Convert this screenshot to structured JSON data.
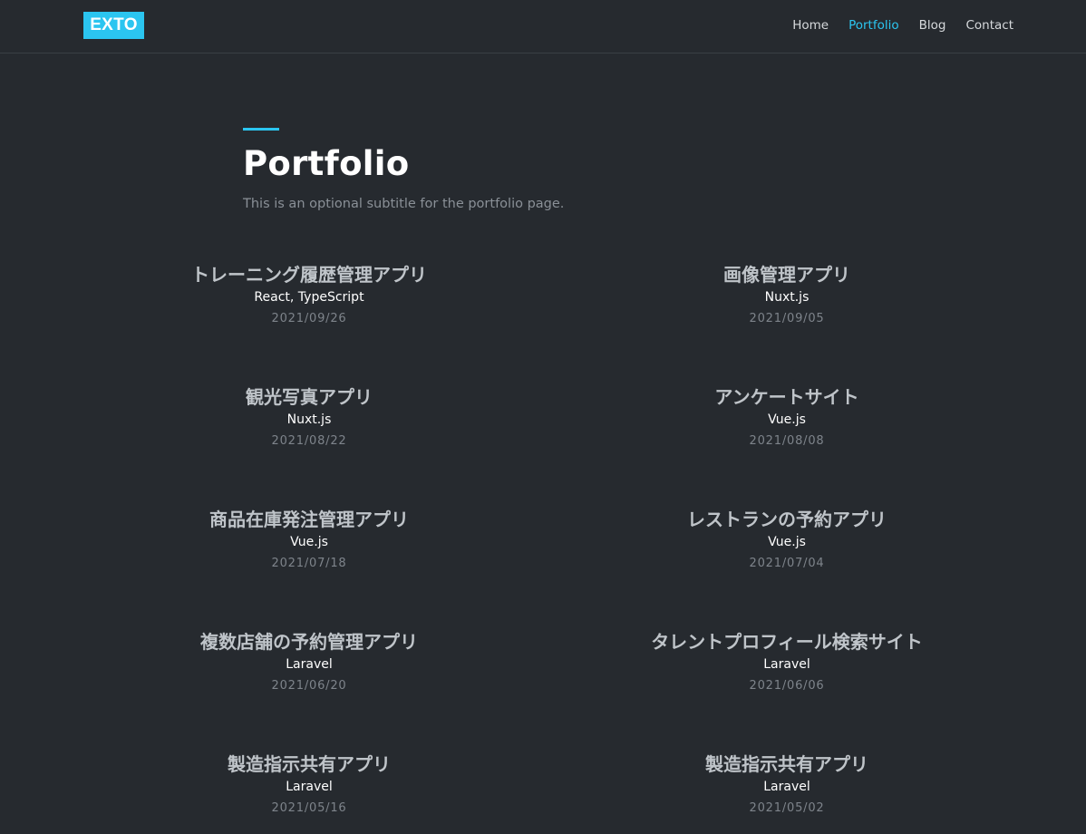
{
  "brand": {
    "logo_text": "EXTO"
  },
  "nav": {
    "items": [
      {
        "label": "Home"
      },
      {
        "label": "Portfolio"
      },
      {
        "label": "Blog"
      },
      {
        "label": "Contact"
      }
    ],
    "active": "Portfolio"
  },
  "colors": {
    "background": "#262a2f",
    "accent": "#2bc5f0",
    "title": "#ffffff",
    "item_title": "#bfc4c9",
    "muted": "#7e848b"
  },
  "header": {
    "title": "Portfolio",
    "subtitle": "This is an optional subtitle for the portfolio page."
  },
  "portfolio": {
    "items": [
      {
        "title": "トレーニング履歴管理アプリ",
        "tech": "React, TypeScript",
        "date": "2021/09/26"
      },
      {
        "title": "画像管理アプリ",
        "tech": "Nuxt.js",
        "date": "2021/09/05"
      },
      {
        "title": "観光写真アプリ",
        "tech": "Nuxt.js",
        "date": "2021/08/22"
      },
      {
        "title": "アンケートサイト",
        "tech": "Vue.js",
        "date": "2021/08/08"
      },
      {
        "title": "商品在庫発注管理アプリ",
        "tech": "Vue.js",
        "date": "2021/07/18"
      },
      {
        "title": "レストランの予約アプリ",
        "tech": "Vue.js",
        "date": "2021/07/04"
      },
      {
        "title": "複数店舗の予約管理アプリ",
        "tech": "Laravel",
        "date": "2021/06/20"
      },
      {
        "title": "タレントプロフィール検索サイト",
        "tech": "Laravel",
        "date": "2021/06/06"
      },
      {
        "title": "製造指示共有アプリ",
        "tech": "Laravel",
        "date": "2021/05/16"
      },
      {
        "title": "製造指示共有アプリ",
        "tech": "Laravel",
        "date": "2021/05/02"
      }
    ]
  }
}
